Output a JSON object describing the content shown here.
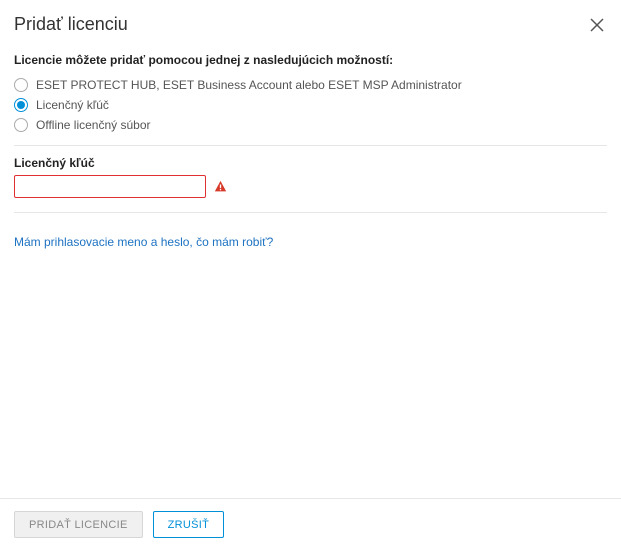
{
  "header": {
    "title": "Pridať licenciu"
  },
  "intro_label": "Licencie môžete pridať pomocou jednej z nasledujúcich možností:",
  "options": [
    {
      "label": "ESET PROTECT HUB, ESET Business Account alebo ESET MSP Administrator",
      "selected": false
    },
    {
      "label": "Licenčný kľúč",
      "selected": true
    },
    {
      "label": "Offline licenčný súbor",
      "selected": false
    }
  ],
  "field": {
    "label": "Licenčný kľúč",
    "value": "",
    "error": true
  },
  "help_link": "Mám prihlasovacie meno a heslo, čo mám robiť?",
  "footer": {
    "primary": "PRIDAŤ LICENCIE",
    "secondary": "ZRUŠIŤ"
  }
}
